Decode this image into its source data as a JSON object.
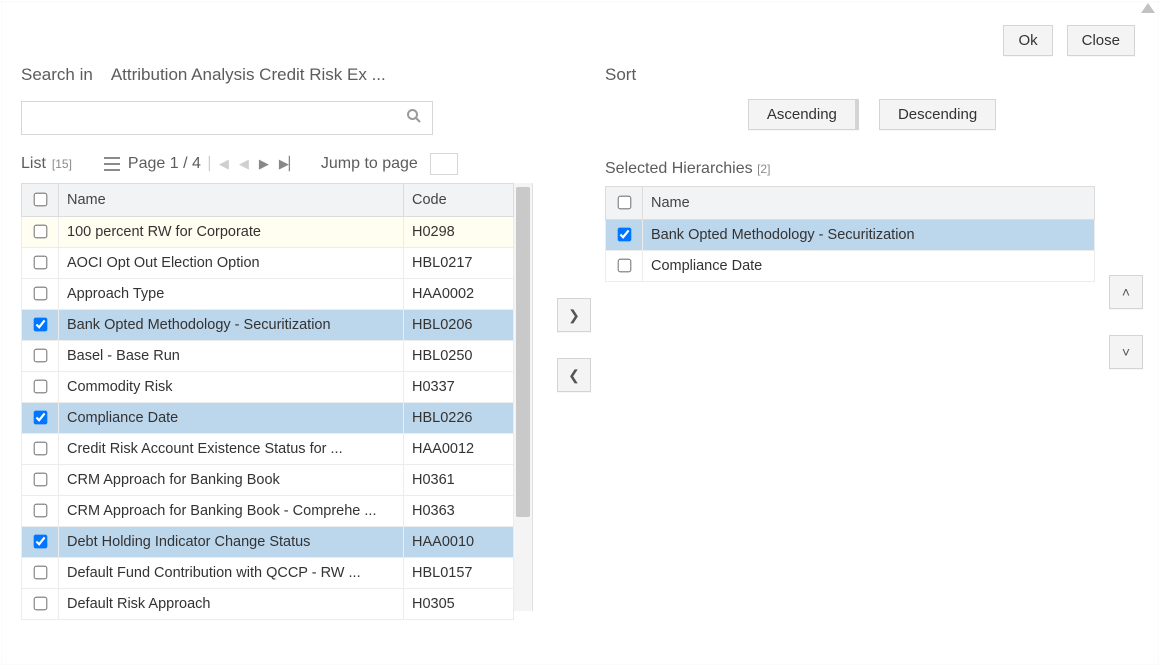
{
  "buttons": {
    "ok": "Ok",
    "close": "Close",
    "ascending": "Ascending",
    "descending": "Descending"
  },
  "search": {
    "label": "Search in",
    "context": "Attribution Analysis Credit Risk Ex ...",
    "value": ""
  },
  "list": {
    "label": "List",
    "count": "[15]",
    "page_label": "Page 1 / 4",
    "jump_label": "Jump to page",
    "columns": {
      "name": "Name",
      "code": "Code"
    },
    "rows": [
      {
        "name": "100 percent RW for Corporate",
        "code": "H0298",
        "checked": false,
        "style": "highlight"
      },
      {
        "name": "AOCI Opt Out Election Option",
        "code": "HBL0217",
        "checked": false
      },
      {
        "name": "Approach Type",
        "code": "HAA0002",
        "checked": false
      },
      {
        "name": "Bank Opted Methodology - Securitization",
        "code": "HBL0206",
        "checked": true,
        "style": "selected"
      },
      {
        "name": "Basel - Base Run",
        "code": "HBL0250",
        "checked": false
      },
      {
        "name": "Commodity Risk",
        "code": "H0337",
        "checked": false
      },
      {
        "name": "Compliance Date",
        "code": "HBL0226",
        "checked": true,
        "style": "selected"
      },
      {
        "name": "Credit Risk Account Existence Status for ...",
        "code": "HAA0012",
        "checked": false
      },
      {
        "name": "CRM Approach for Banking Book",
        "code": "H0361",
        "checked": false
      },
      {
        "name": "CRM Approach for Banking Book - Comprehe ...",
        "code": "H0363",
        "checked": false
      },
      {
        "name": "Debt Holding Indicator Change Status",
        "code": "HAA0010",
        "checked": true,
        "style": "selected"
      },
      {
        "name": "Default Fund Contribution with QCCP - RW ...",
        "code": "HBL0157",
        "checked": false
      },
      {
        "name": "Default Risk Approach",
        "code": "H0305",
        "checked": false
      }
    ]
  },
  "sort": {
    "label": "Sort"
  },
  "selected": {
    "label": "Selected Hierarchies",
    "count": "[2]",
    "columns": {
      "name": "Name"
    },
    "rows": [
      {
        "name": "Bank Opted Methodology - Securitization",
        "checked": true,
        "style": "selected"
      },
      {
        "name": "Compliance Date",
        "checked": false
      }
    ]
  }
}
